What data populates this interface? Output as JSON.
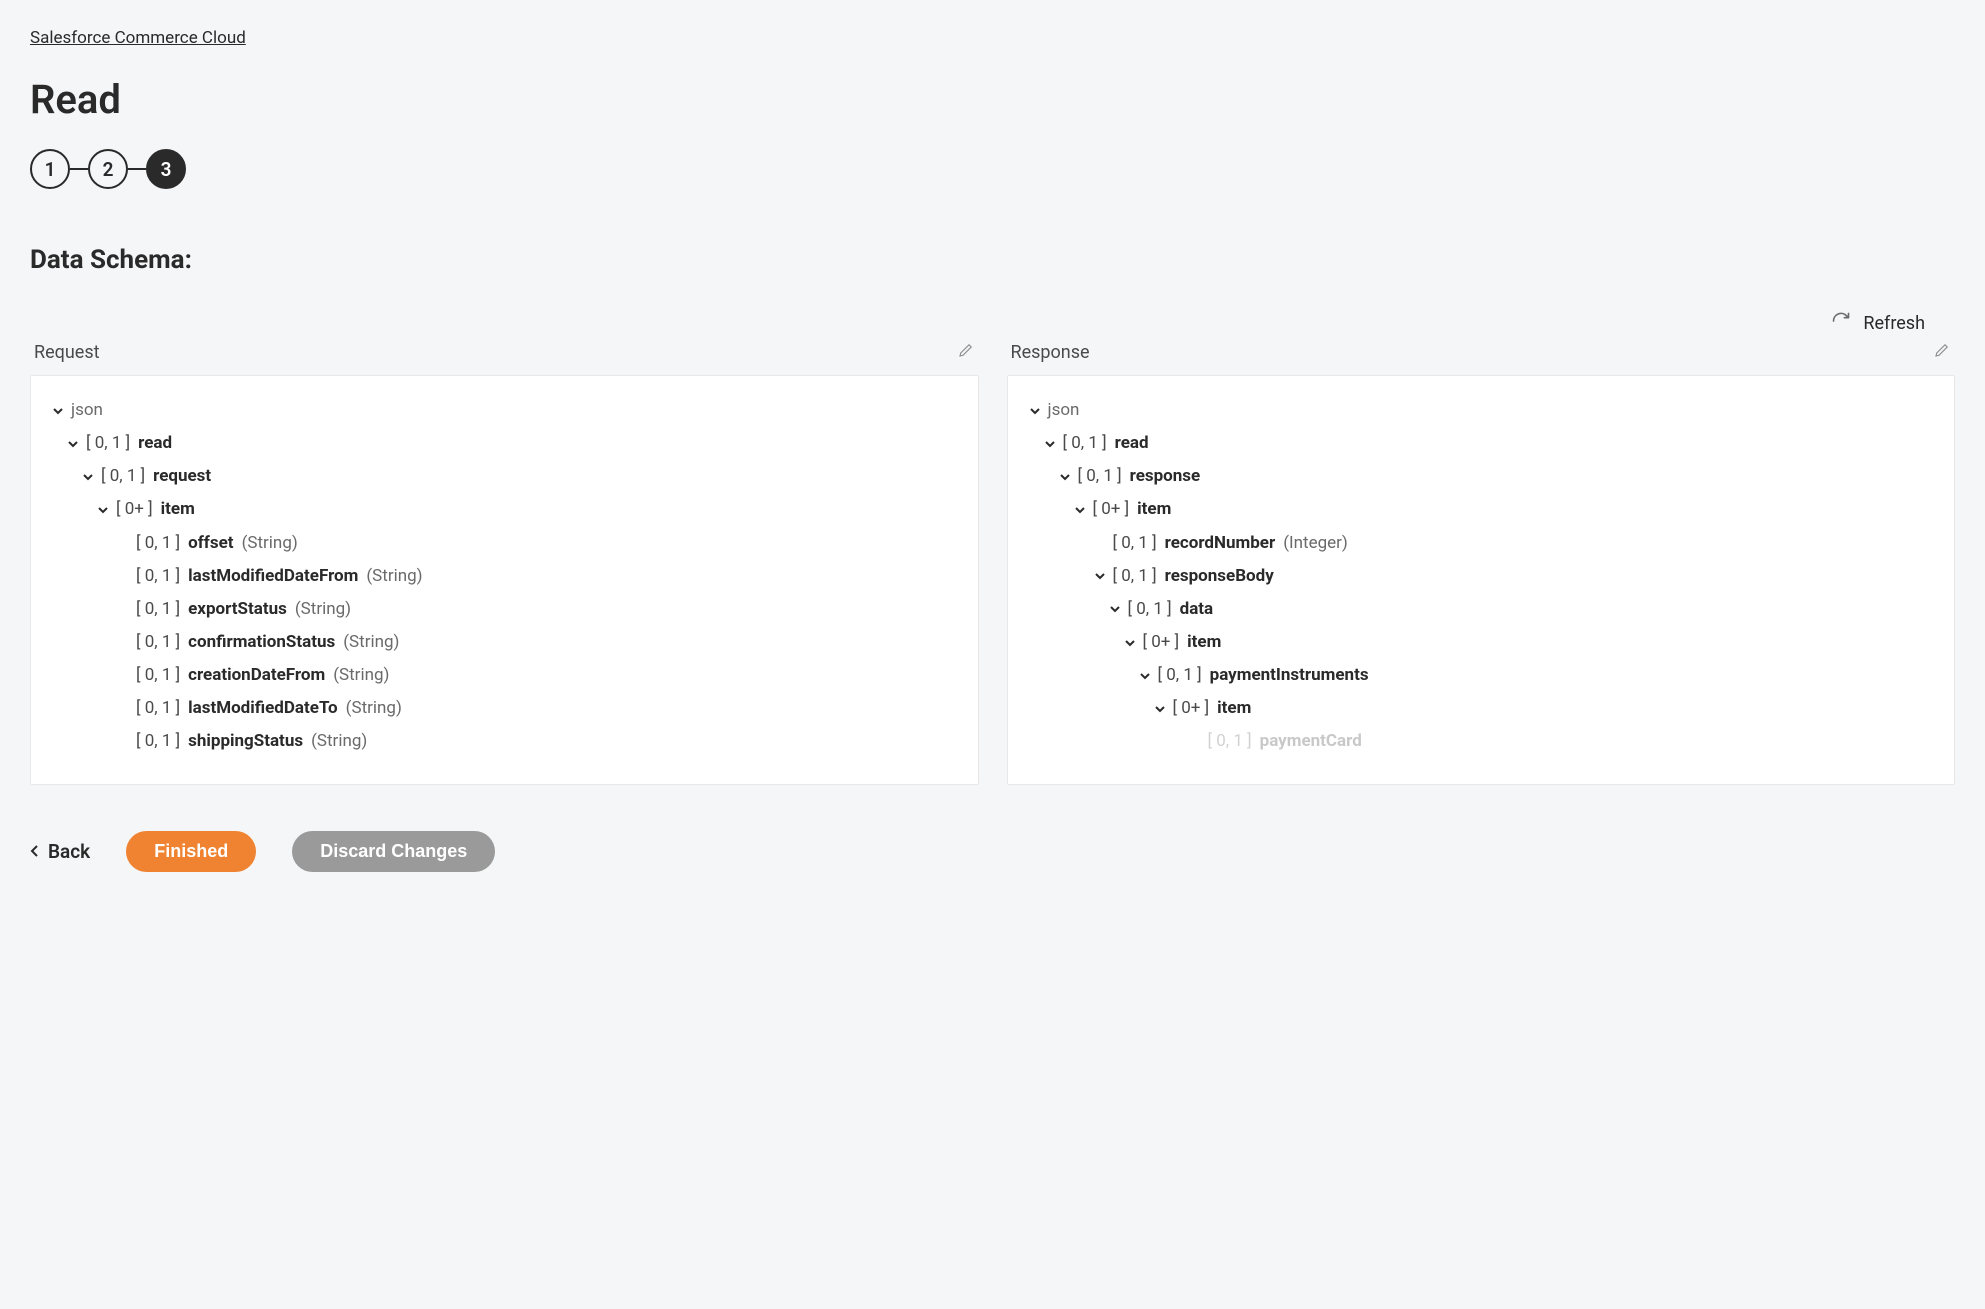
{
  "breadcrumb": "Salesforce Commerce Cloud",
  "page_title": "Read",
  "stepper": {
    "steps": [
      "1",
      "2",
      "3"
    ],
    "active_index": 2
  },
  "section_title": "Data Schema:",
  "refresh_label": "Refresh",
  "panels": {
    "request": {
      "title": "Request",
      "tree": [
        {
          "indent": 0,
          "chevron": true,
          "cardinality": "",
          "name": "json",
          "type": "",
          "root": true
        },
        {
          "indent": 1,
          "chevron": true,
          "cardinality": "[ 0, 1 ]",
          "name": "read",
          "type": ""
        },
        {
          "indent": 2,
          "chevron": true,
          "cardinality": "[ 0, 1 ]",
          "name": "request",
          "type": ""
        },
        {
          "indent": 3,
          "chevron": true,
          "cardinality": "[ 0+ ]",
          "name": "item",
          "type": ""
        },
        {
          "indent": 4,
          "chevron": false,
          "cardinality": "[ 0, 1 ]",
          "name": "offset",
          "type": "(String)"
        },
        {
          "indent": 4,
          "chevron": false,
          "cardinality": "[ 0, 1 ]",
          "name": "lastModifiedDateFrom",
          "type": "(String)"
        },
        {
          "indent": 4,
          "chevron": false,
          "cardinality": "[ 0, 1 ]",
          "name": "exportStatus",
          "type": "(String)"
        },
        {
          "indent": 4,
          "chevron": false,
          "cardinality": "[ 0, 1 ]",
          "name": "confirmationStatus",
          "type": "(String)"
        },
        {
          "indent": 4,
          "chevron": false,
          "cardinality": "[ 0, 1 ]",
          "name": "creationDateFrom",
          "type": "(String)"
        },
        {
          "indent": 4,
          "chevron": false,
          "cardinality": "[ 0, 1 ]",
          "name": "lastModifiedDateTo",
          "type": "(String)"
        },
        {
          "indent": 4,
          "chevron": false,
          "cardinality": "[ 0, 1 ]",
          "name": "shippingStatus",
          "type": "(String)"
        }
      ]
    },
    "response": {
      "title": "Response",
      "tree": [
        {
          "indent": 0,
          "chevron": true,
          "cardinality": "",
          "name": "json",
          "type": "",
          "root": true
        },
        {
          "indent": 1,
          "chevron": true,
          "cardinality": "[ 0, 1 ]",
          "name": "read",
          "type": ""
        },
        {
          "indent": 2,
          "chevron": true,
          "cardinality": "[ 0, 1 ]",
          "name": "response",
          "type": ""
        },
        {
          "indent": 3,
          "chevron": true,
          "cardinality": "[ 0+ ]",
          "name": "item",
          "type": ""
        },
        {
          "indent": 4,
          "chevron": false,
          "cardinality": "[ 0, 1 ]",
          "name": "recordNumber",
          "type": "(Integer)"
        },
        {
          "indent": 4,
          "chevron": true,
          "cardinality": "[ 0, 1 ]",
          "name": "responseBody",
          "type": ""
        },
        {
          "indent": 5,
          "chevron": true,
          "cardinality": "[ 0, 1 ]",
          "name": "data",
          "type": ""
        },
        {
          "indent": 6,
          "chevron": true,
          "cardinality": "[ 0+ ]",
          "name": "item",
          "type": ""
        },
        {
          "indent": 7,
          "chevron": true,
          "cardinality": "[ 0, 1 ]",
          "name": "paymentInstruments",
          "type": ""
        },
        {
          "indent": 8,
          "chevron": true,
          "cardinality": "[ 0+ ]",
          "name": "item",
          "type": ""
        },
        {
          "indent": 10,
          "chevron": false,
          "cardinality": "[ 0, 1 ]",
          "name": "paymentCard",
          "type": "",
          "cutoff": true
        }
      ]
    }
  },
  "footer": {
    "back": "Back",
    "finished": "Finished",
    "discard": "Discard Changes"
  }
}
